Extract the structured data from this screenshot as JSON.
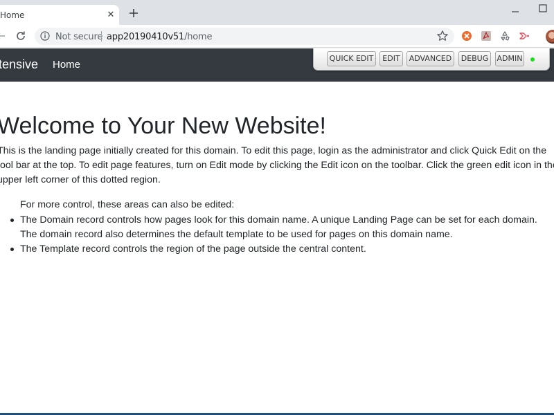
{
  "browser": {
    "tab": {
      "title": "Home",
      "close_glyph": "✕"
    },
    "new_tab_icon": "plus-icon",
    "security_label": "Not secure",
    "url_host": "app20190410v51",
    "url_path": "/home",
    "extensions": [
      "orange-circle-extension-icon",
      "pdf-extension-icon",
      "recycle-extension-icon",
      "share-arrow-extension-icon"
    ]
  },
  "site": {
    "brand": "tensive",
    "nav": {
      "home": "Home"
    }
  },
  "admin_toolbar": {
    "buttons": [
      "QUICK EDIT",
      "EDIT",
      "ADVANCED",
      "DEBUG",
      "ADMIN"
    ],
    "status_color": "#19e019"
  },
  "page": {
    "title": "Welcome to Your New Website!",
    "intro": "This is the landing page initially created for this domain. To edit this page, login as the administrator and click Quick Edit on the tool bar at the top. To edit page features, turn on Edit mode by clicking the Edit icon on the toolbar. Click the green edit icon in the upper left corner of this dotted region.",
    "more_control": "For more control, these areas can also be edited:",
    "bullets": [
      "The Domain record controls how pages look for this domain name. A unique Landing Page can be set for each domain. The domain record also determines the default template to be used for pages on this domain name.",
      "The Template record controls the region of the page outside the central content."
    ]
  },
  "colors": {
    "navbar": "#343a40",
    "tabstrip": "#dee1e6",
    "text": "#212529"
  }
}
